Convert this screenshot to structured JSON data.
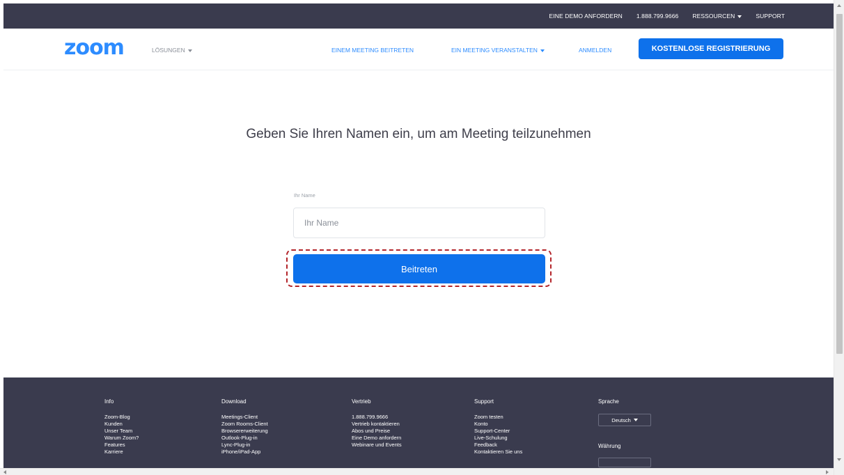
{
  "topbar": {
    "demo": "EINE DEMO ANFORDERN",
    "phone": "1.888.799.9666",
    "resources": "RESSOURCEN",
    "support": "SUPPORT"
  },
  "nav": {
    "logo": "zoom",
    "solutions": "LÖSUNGEN",
    "join": "EINEM MEETING BEITRETEN",
    "host": "EIN MEETING VERANSTALTEN",
    "signin": "ANMELDEN",
    "signup": "KOSTENLOSE REGISTRIERUNG"
  },
  "main": {
    "heading": "Geben Sie Ihren Namen ein, um am Meeting teilzunehmen",
    "name_label": "Ihr Name",
    "name_placeholder": "Ihr Name",
    "name_value": "",
    "join_button": "Beitreten"
  },
  "footer": {
    "columns": [
      {
        "heading": "Info",
        "items": [
          "Zoom-Blog",
          "Kunden",
          "Unser Team",
          "Warum Zoom?",
          "Features",
          "Karriere"
        ]
      },
      {
        "heading": "Download",
        "items": [
          "Meetings-Client",
          "Zoom Rooms-Client",
          "Browsererweiterung",
          "Outlook-Plug-in",
          "Lync-Plug-in",
          "iPhone/iPad-App"
        ]
      },
      {
        "heading": "Vertrieb",
        "items": [
          "1.888.799.9666",
          "Vertrieb kontaktieren",
          "Abos und Preise",
          "Eine Demo anfordern",
          "Webinare und Events"
        ]
      },
      {
        "heading": "Support",
        "items": [
          "Zoom testen",
          "Konto",
          "Support-Center",
          "Live-Schulung",
          "Feedback",
          "Kontaktieren Sie uns"
        ]
      }
    ],
    "language_heading": "Sprache",
    "language_value": "Deutsch",
    "currency_heading": "Währung"
  },
  "colors": {
    "brand_blue": "#2d8cff",
    "button_blue": "#0e71eb",
    "dark_bar": "#3a3b4e",
    "highlight_red": "#b3242a"
  }
}
